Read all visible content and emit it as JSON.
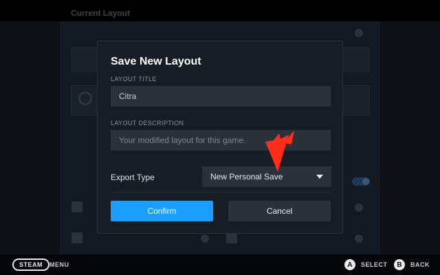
{
  "background": {
    "section_title": "Current Layout"
  },
  "dialog": {
    "title": "Save New Layout",
    "layout_title": {
      "label": "LAYOUT TITLE",
      "value": "Citra"
    },
    "layout_description": {
      "label": "LAYOUT DESCRIPTION",
      "placeholder": "Your modified layout for this game."
    },
    "export_type": {
      "label": "Export Type",
      "selected": "New Personal Save"
    },
    "confirm_label": "Confirm",
    "cancel_label": "Cancel"
  },
  "footer": {
    "steam_label": "STEAM",
    "menu_label": "MENU",
    "a_glyph": "A",
    "select_label": "SELECT",
    "b_glyph": "B",
    "back_label": "BACK"
  },
  "colors": {
    "accent": "#1a9fff",
    "dialog_bg": "#171d25",
    "annotation": "#ff2d1a"
  },
  "icons": [
    "caret-down-icon",
    "search-icon",
    "annotation-arrow-icon"
  ]
}
